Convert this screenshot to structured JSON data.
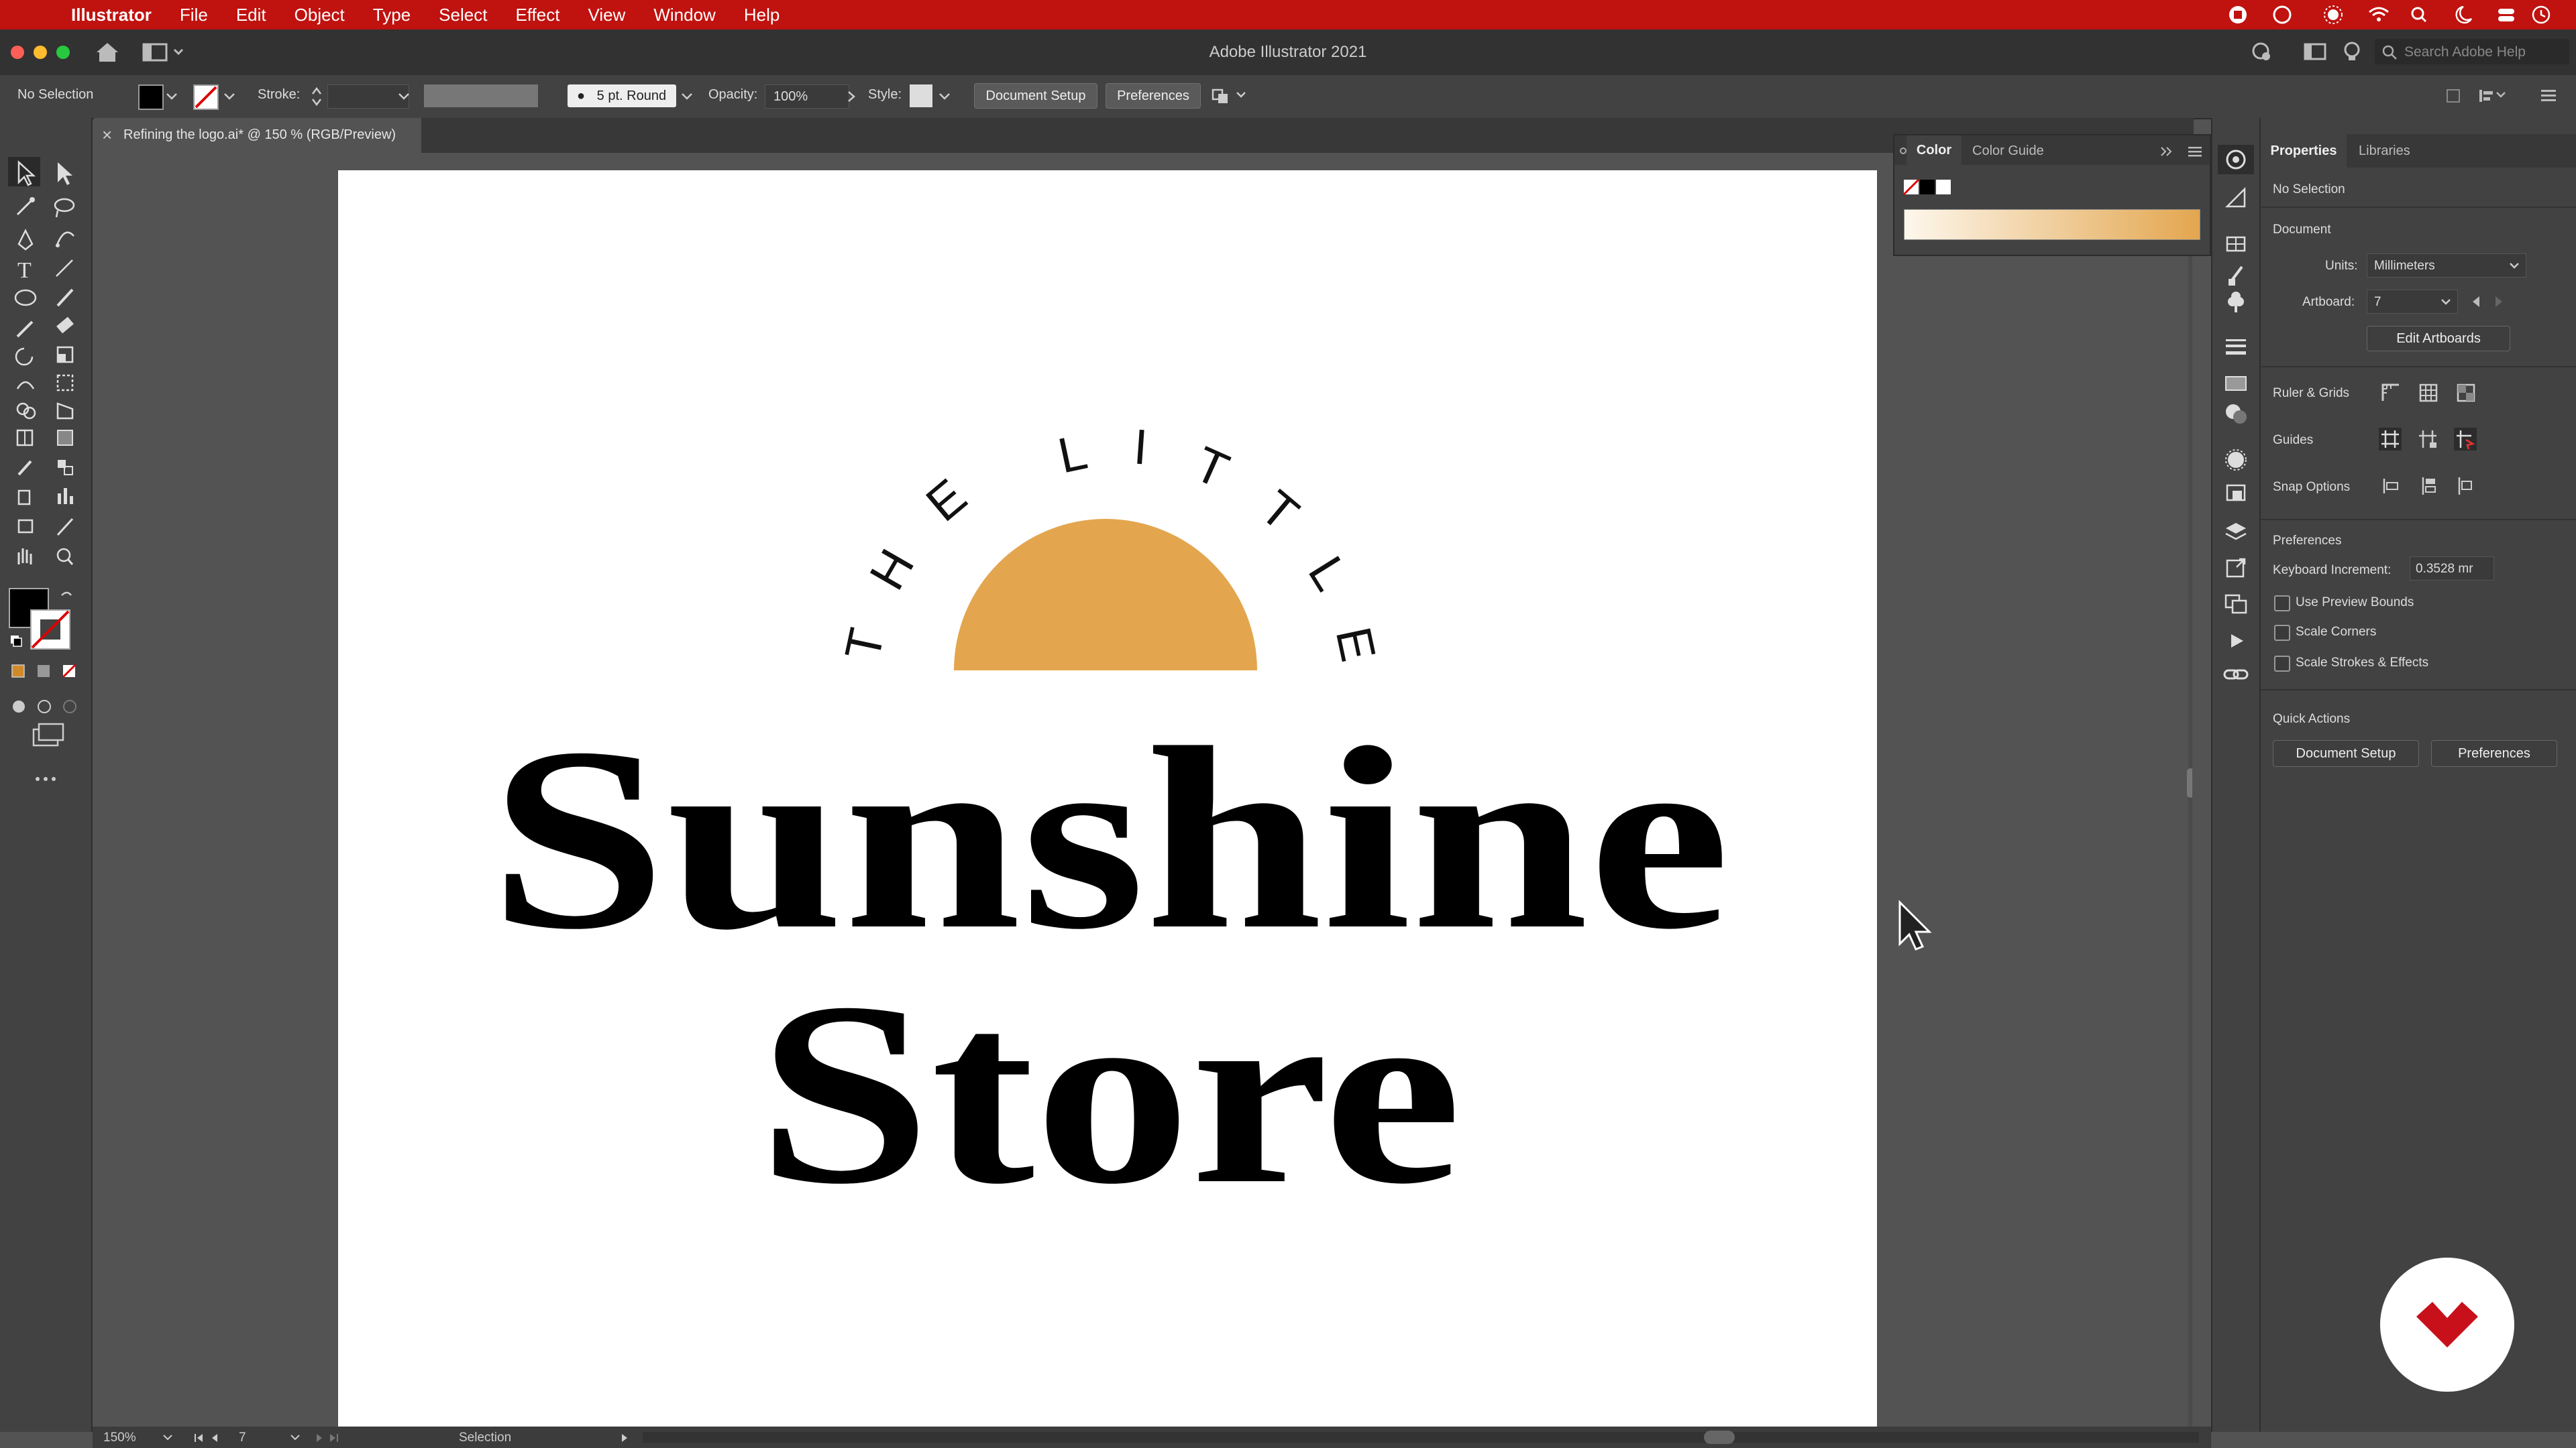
{
  "menubar": {
    "app": "Illustrator",
    "items": [
      "File",
      "Edit",
      "Object",
      "Type",
      "Select",
      "Effect",
      "View",
      "Window",
      "Help"
    ]
  },
  "window": {
    "title": "Adobe Illustrator 2021",
    "search_placeholder": "Search Adobe Help"
  },
  "controlbar": {
    "selection": "No Selection",
    "stroke_label": "Stroke:",
    "brush": "5 pt. Round",
    "opacity_label": "Opacity:",
    "opacity_value": "100%",
    "style_label": "Style:",
    "document_setup": "Document Setup",
    "preferences": "Preferences"
  },
  "doc_tab": {
    "close": "×",
    "title": "Refining the logo.ai* @ 150 % (RGB/Preview)"
  },
  "color_panel": {
    "tabs": [
      "Color",
      "Color Guide"
    ]
  },
  "artwork": {
    "arc_letters": [
      "T",
      "H",
      "E",
      "L",
      "I",
      "T",
      "T",
      "L",
      "E"
    ],
    "line1": "Sunshine",
    "line2": "Store",
    "sun_color": "#e3a64f"
  },
  "properties": {
    "tabs": [
      "Properties",
      "Libraries"
    ],
    "no_selection": "No Selection",
    "document": "Document",
    "units_label": "Units:",
    "units_value": "Millimeters",
    "artboard_label": "Artboard:",
    "artboard_value": "7",
    "edit_artboards": "Edit Artboards",
    "ruler_grids": "Ruler & Grids",
    "guides": "Guides",
    "snap_options": "Snap Options",
    "preferences_heading": "Preferences",
    "keyboard_increment_label": "Keyboard Increment:",
    "keyboard_increment_value": "0.3528 mr",
    "use_preview_bounds": "Use Preview Bounds",
    "scale_corners": "Scale Corners",
    "scale_strokes": "Scale Strokes & Effects",
    "quick_actions": "Quick Actions",
    "document_setup": "Document Setup",
    "preferences_btn": "Preferences"
  },
  "statusbar": {
    "zoom": "150%",
    "artboard": "7",
    "tool": "Selection"
  },
  "colors": {
    "menubar": "#c0120f",
    "accent_sun": "#e3a64f",
    "watermark": "#c8101a"
  }
}
